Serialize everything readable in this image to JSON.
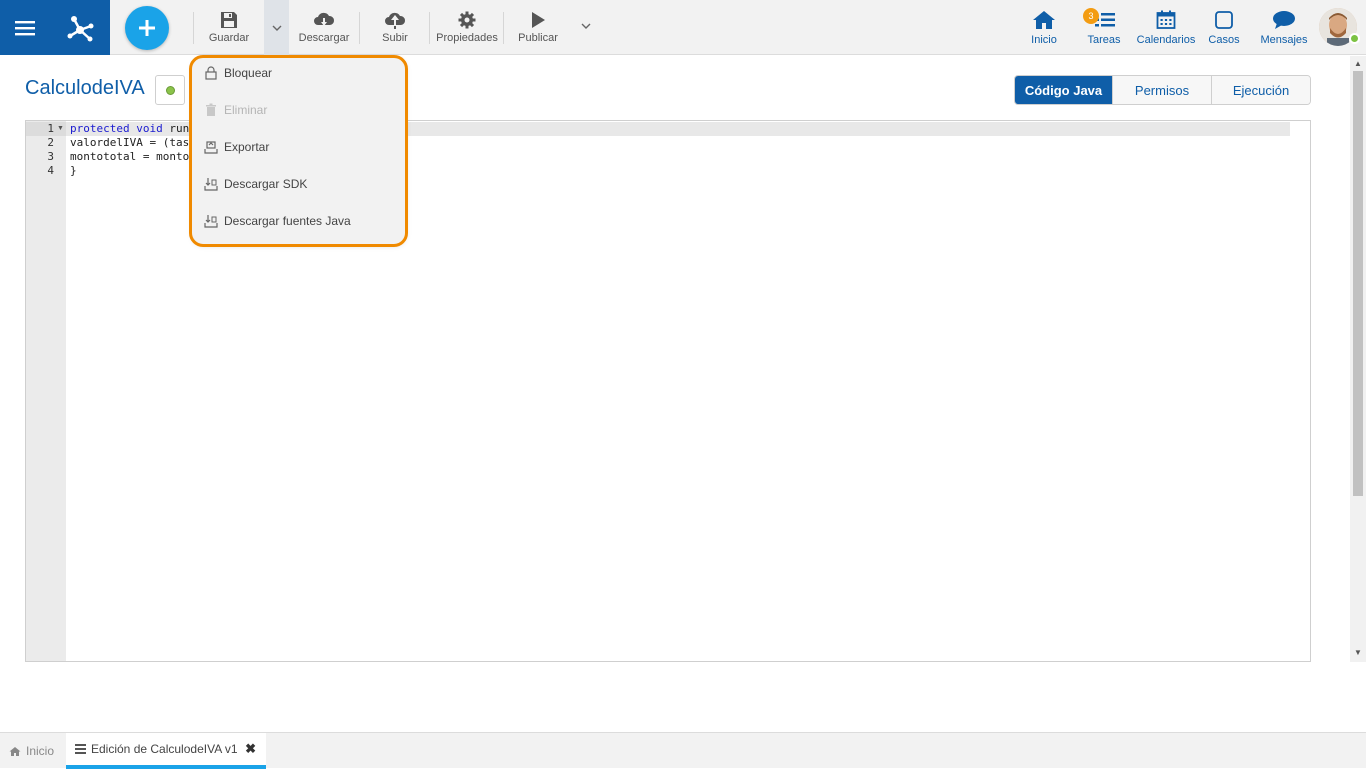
{
  "toolbar": {
    "guardar": "Guardar",
    "descargar": "Descargar",
    "subir": "Subir",
    "propiedades": "Propiedades",
    "publicar": "Publicar"
  },
  "nav": {
    "inicio": "Inicio",
    "tareas": "Tareas",
    "tareas_badge": "3",
    "calendarios": "Calendarios",
    "casos": "Casos",
    "mensajes": "Mensajes"
  },
  "page": {
    "title": "CalculodeIVA",
    "status_color": "#8bc34a"
  },
  "tabs": [
    {
      "label": "Código Java",
      "active": true
    },
    {
      "label": "Permisos",
      "active": false
    },
    {
      "label": "Ejecución",
      "active": false
    }
  ],
  "editor": {
    "line_numbers": [
      "1",
      "2",
      "3",
      "4"
    ],
    "lines": [
      {
        "keyword": "protected void",
        "rest": " run("
      },
      {
        "keyword": "",
        "rest": "valordelIVA = (tas"
      },
      {
        "keyword": "",
        "rest": "montototal = monto"
      },
      {
        "keyword": "",
        "rest": "}"
      }
    ]
  },
  "dropdown": {
    "items": [
      {
        "label": "Bloquear",
        "icon": "lock-icon",
        "enabled": true
      },
      {
        "label": "Eliminar",
        "icon": "trash-icon",
        "enabled": false
      },
      {
        "label": "Exportar",
        "icon": "export-icon",
        "enabled": true
      },
      {
        "label": "Descargar SDK",
        "icon": "download-sdk-icon",
        "enabled": true
      },
      {
        "label": "Descargar fuentes Java",
        "icon": "download-source-icon",
        "enabled": true
      }
    ],
    "highlight_color": "#f08a00"
  },
  "bottom_tabs": {
    "home": "Inicio",
    "current": "Edición de CalculodeIVA v1"
  },
  "colors": {
    "brand": "#0f5ea8",
    "accent": "#1aa3e8",
    "badge": "#f39c12"
  }
}
